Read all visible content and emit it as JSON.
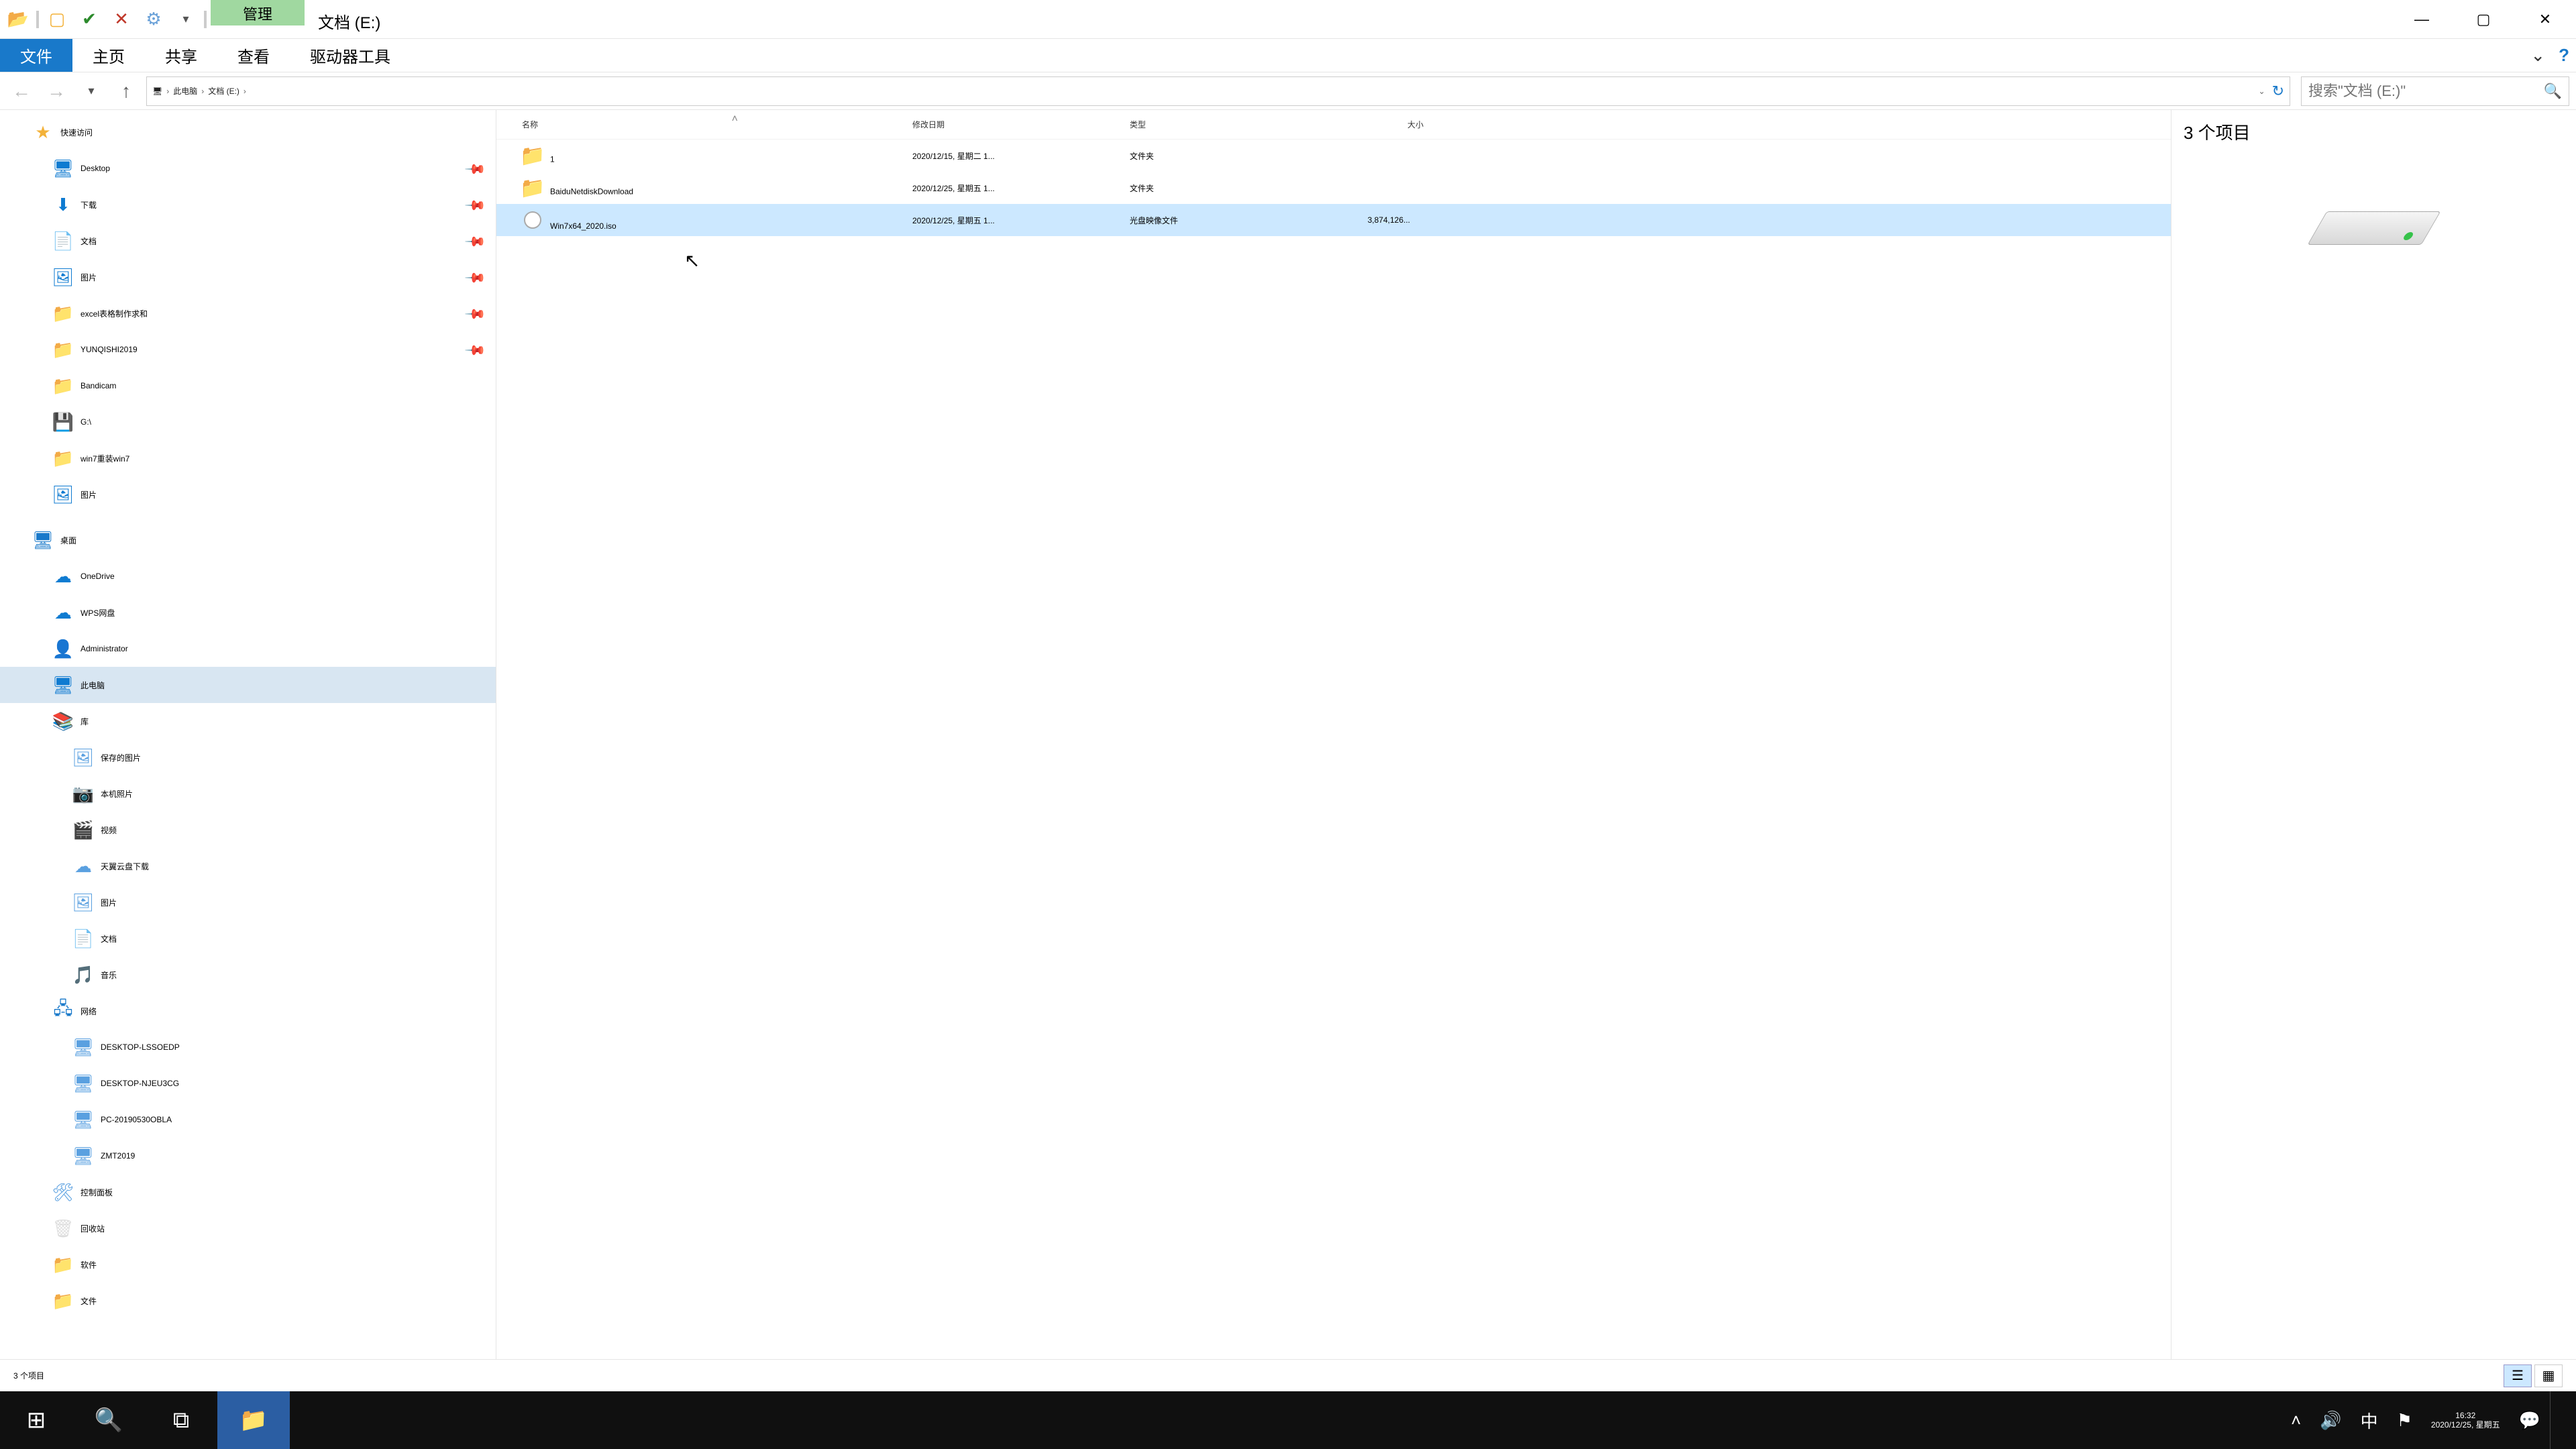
{
  "titlebar": {
    "context_label": "管理",
    "window_title": "文档 (E:)"
  },
  "ribbon": {
    "file": "文件",
    "home": "主页",
    "share": "共享",
    "view": "查看",
    "drivetools": "驱动器工具"
  },
  "breadcrumb": {
    "root_icon": "🖥",
    "this_pc": "此电脑",
    "current": "文档 (E:)"
  },
  "search": {
    "placeholder": "搜索\"文档 (E:)\""
  },
  "nav": {
    "quick_access": "快速访问",
    "qa_items": [
      {
        "icon": "🖥",
        "label": "Desktop",
        "pin": true,
        "c": "#0f7bd1"
      },
      {
        "icon": "⬇",
        "label": "下载",
        "pin": true,
        "c": "#0f7bd1"
      },
      {
        "icon": "📄",
        "label": "文档",
        "pin": true,
        "c": "#0f7bd1"
      },
      {
        "icon": "🖼",
        "label": "图片",
        "pin": true,
        "c": "#0f7bd1"
      },
      {
        "icon": "📁",
        "label": "excel表格制作求和",
        "pin": true,
        "c": "#f8d775"
      },
      {
        "icon": "📁",
        "label": "YUNQISHI2019",
        "pin": true,
        "c": "#f8d775"
      },
      {
        "icon": "📁",
        "label": "Bandicam",
        "pin": false,
        "c": "#f8d775"
      },
      {
        "icon": "💾",
        "label": "G:\\",
        "pin": false,
        "c": "#5aa0e0"
      },
      {
        "icon": "📁",
        "label": "win7重装win7",
        "pin": false,
        "c": "#f8d775"
      },
      {
        "icon": "🖼",
        "label": "图片",
        "pin": false,
        "c": "#0f7bd1"
      }
    ],
    "desktop": "桌面",
    "desktop_items": [
      {
        "icon": "☁",
        "label": "OneDrive",
        "c": "#0f7bd1"
      },
      {
        "icon": "☁",
        "label": "WPS网盘",
        "c": "#0f7bd1"
      },
      {
        "icon": "👤",
        "label": "Administrator",
        "c": "#f3b23a"
      },
      {
        "icon": "🖥",
        "label": "此电脑",
        "c": "#0f7bd1",
        "selected": true
      },
      {
        "icon": "📚",
        "label": "库",
        "c": "#d8b060"
      }
    ],
    "libraries": [
      {
        "icon": "🖼",
        "label": "保存的图片"
      },
      {
        "icon": "📷",
        "label": "本机照片"
      },
      {
        "icon": "🎬",
        "label": "视频"
      },
      {
        "icon": "☁",
        "label": "天翼云盘下载"
      },
      {
        "icon": "🖼",
        "label": "图片"
      },
      {
        "icon": "📄",
        "label": "文档"
      },
      {
        "icon": "🎵",
        "label": "音乐"
      }
    ],
    "network": "网络",
    "network_items": [
      {
        "icon": "🖥",
        "label": "DESKTOP-LSSOEDP"
      },
      {
        "icon": "🖥",
        "label": "DESKTOP-NJEU3CG"
      },
      {
        "icon": "🖥",
        "label": "PC-20190530OBLA"
      },
      {
        "icon": "🖥",
        "label": "ZMT2019"
      }
    ],
    "control_panel": "控制面板",
    "recycle": "回收站",
    "software": "软件",
    "files": "文件"
  },
  "columns": {
    "name": "名称",
    "date": "修改日期",
    "type": "类型",
    "size": "大小"
  },
  "rows": [
    {
      "kind": "folder",
      "name": "1",
      "date": "2020/12/15, 星期二 1...",
      "type": "文件夹",
      "size": ""
    },
    {
      "kind": "folder",
      "name": "BaiduNetdiskDownload",
      "date": "2020/12/25, 星期五 1...",
      "type": "文件夹",
      "size": ""
    },
    {
      "kind": "iso",
      "name": "Win7x64_2020.iso",
      "date": "2020/12/25, 星期五 1...",
      "type": "光盘映像文件",
      "size": "3,874,126...",
      "selected": true
    }
  ],
  "preview": {
    "count": "3 个项目"
  },
  "status": {
    "text": "3 个项目"
  },
  "tray": {
    "ime": "中",
    "time": "16:32",
    "date": "2020/12/25, 星期五"
  }
}
